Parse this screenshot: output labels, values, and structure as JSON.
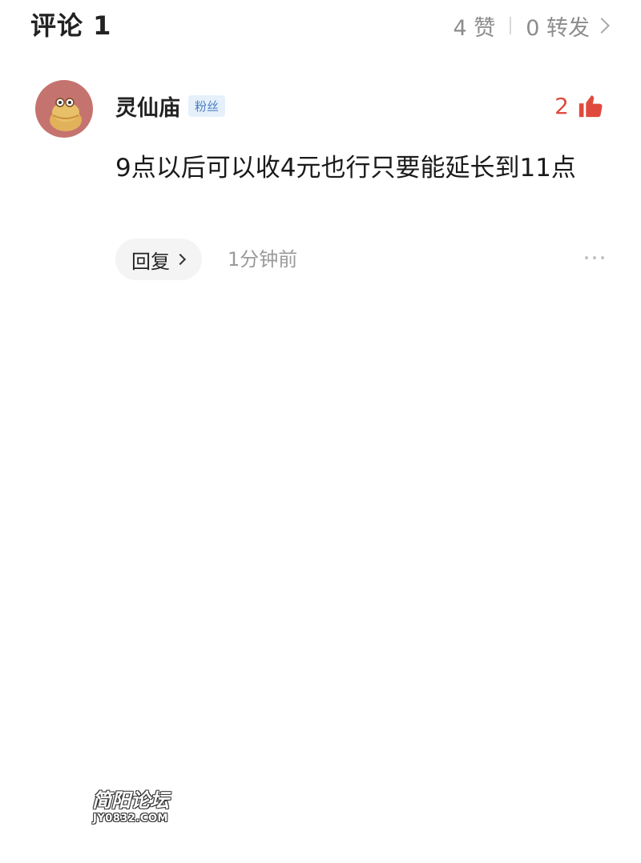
{
  "header": {
    "title": "评论 1",
    "likes_text": "4 赞",
    "shares_text": "0 转发"
  },
  "comment": {
    "author": "灵仙庙",
    "badge": "粉丝",
    "like_count": "2",
    "text": "9点以后可以收4元也行只要能延长到11点",
    "reply_label": "回复",
    "timestamp": "1分钟前"
  },
  "watermark": {
    "logo": "简阳论坛",
    "url": "JY0832.COM"
  },
  "colors": {
    "accent_like": "#e04a3c",
    "badge_bg": "#e6f0fb",
    "badge_text": "#4a7fc1",
    "avatar_bg": "#c5736f"
  },
  "icons": {
    "like": "thumbs-up-icon",
    "more": "more-dots-icon",
    "chevron": "chevron-right-icon"
  }
}
